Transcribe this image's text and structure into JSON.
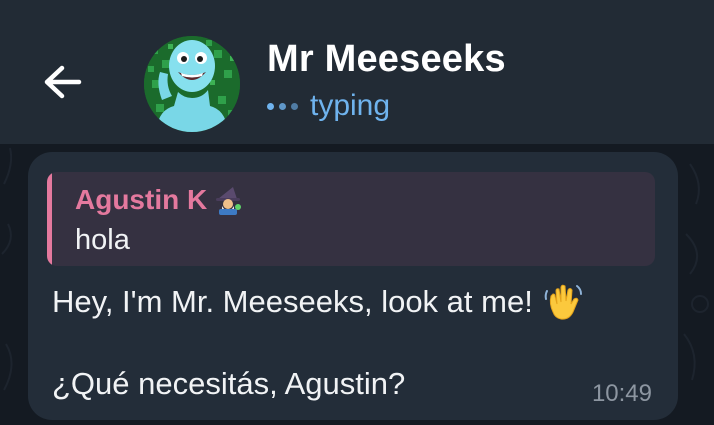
{
  "header": {
    "title": "Mr Meeseeks",
    "status": "typing",
    "back_icon": "arrow-left-icon",
    "avatar_icon": "mr-meeseeks-avatar"
  },
  "message": {
    "reply": {
      "author": "Agustin K",
      "author_icon": "wizard-emoji-icon",
      "text": "hola"
    },
    "text_line1": "Hey, I'm Mr. Meeseeks, look at me!",
    "emoji_icon": "waving-hand-icon",
    "text_line2": "¿Qué necesitás, Agustin?",
    "time": "10:49"
  },
  "colors": {
    "header_bg": "#222b35",
    "chat_bg": "#141a22",
    "bubble_bg": "#232d39",
    "reply_bg": "#353141",
    "accent_blue": "#6fb3ee",
    "reply_accent": "#e4799e"
  }
}
